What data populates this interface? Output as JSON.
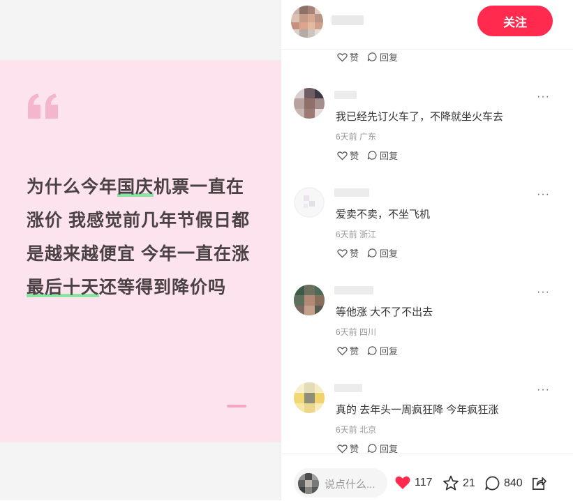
{
  "post": {
    "text_parts": [
      {
        "text": "为什么今年",
        "hl": false
      },
      {
        "text": "国庆",
        "hl": true
      },
      {
        "text": "机票一直在涨价 我感觉前几年节假日都是越来越便宜 今年一直在涨 ",
        "hl": false
      },
      {
        "text": "最后十天",
        "hl": true
      },
      {
        "text": "还等得到降价吗",
        "hl": false
      }
    ],
    "accent_color": "#fde3ee"
  },
  "header": {
    "follow_label": "关注"
  },
  "actions": {
    "like_label": "赞",
    "reply_label": "回复"
  },
  "comments": [
    {
      "text": "我已经先订火车了，不降就坐火车去",
      "meta": "6天前 广东"
    },
    {
      "text": "爱卖不卖，不坐飞机",
      "meta": "6天前 浙江"
    },
    {
      "text": "等他涨 大不了不出去",
      "meta": "6天前 四川"
    },
    {
      "text": "真的 去年头一周疯狂降 今年疯狂涨",
      "meta": "6天前 北京"
    }
  ],
  "more_label": "···",
  "bottom": {
    "placeholder": "说点什么...",
    "likes": "117",
    "favorites": "21",
    "comments": "840"
  },
  "colors": {
    "brand": "#ff2a4e",
    "card_bg": "#fde3ee",
    "highlight": "#8de3a3"
  }
}
